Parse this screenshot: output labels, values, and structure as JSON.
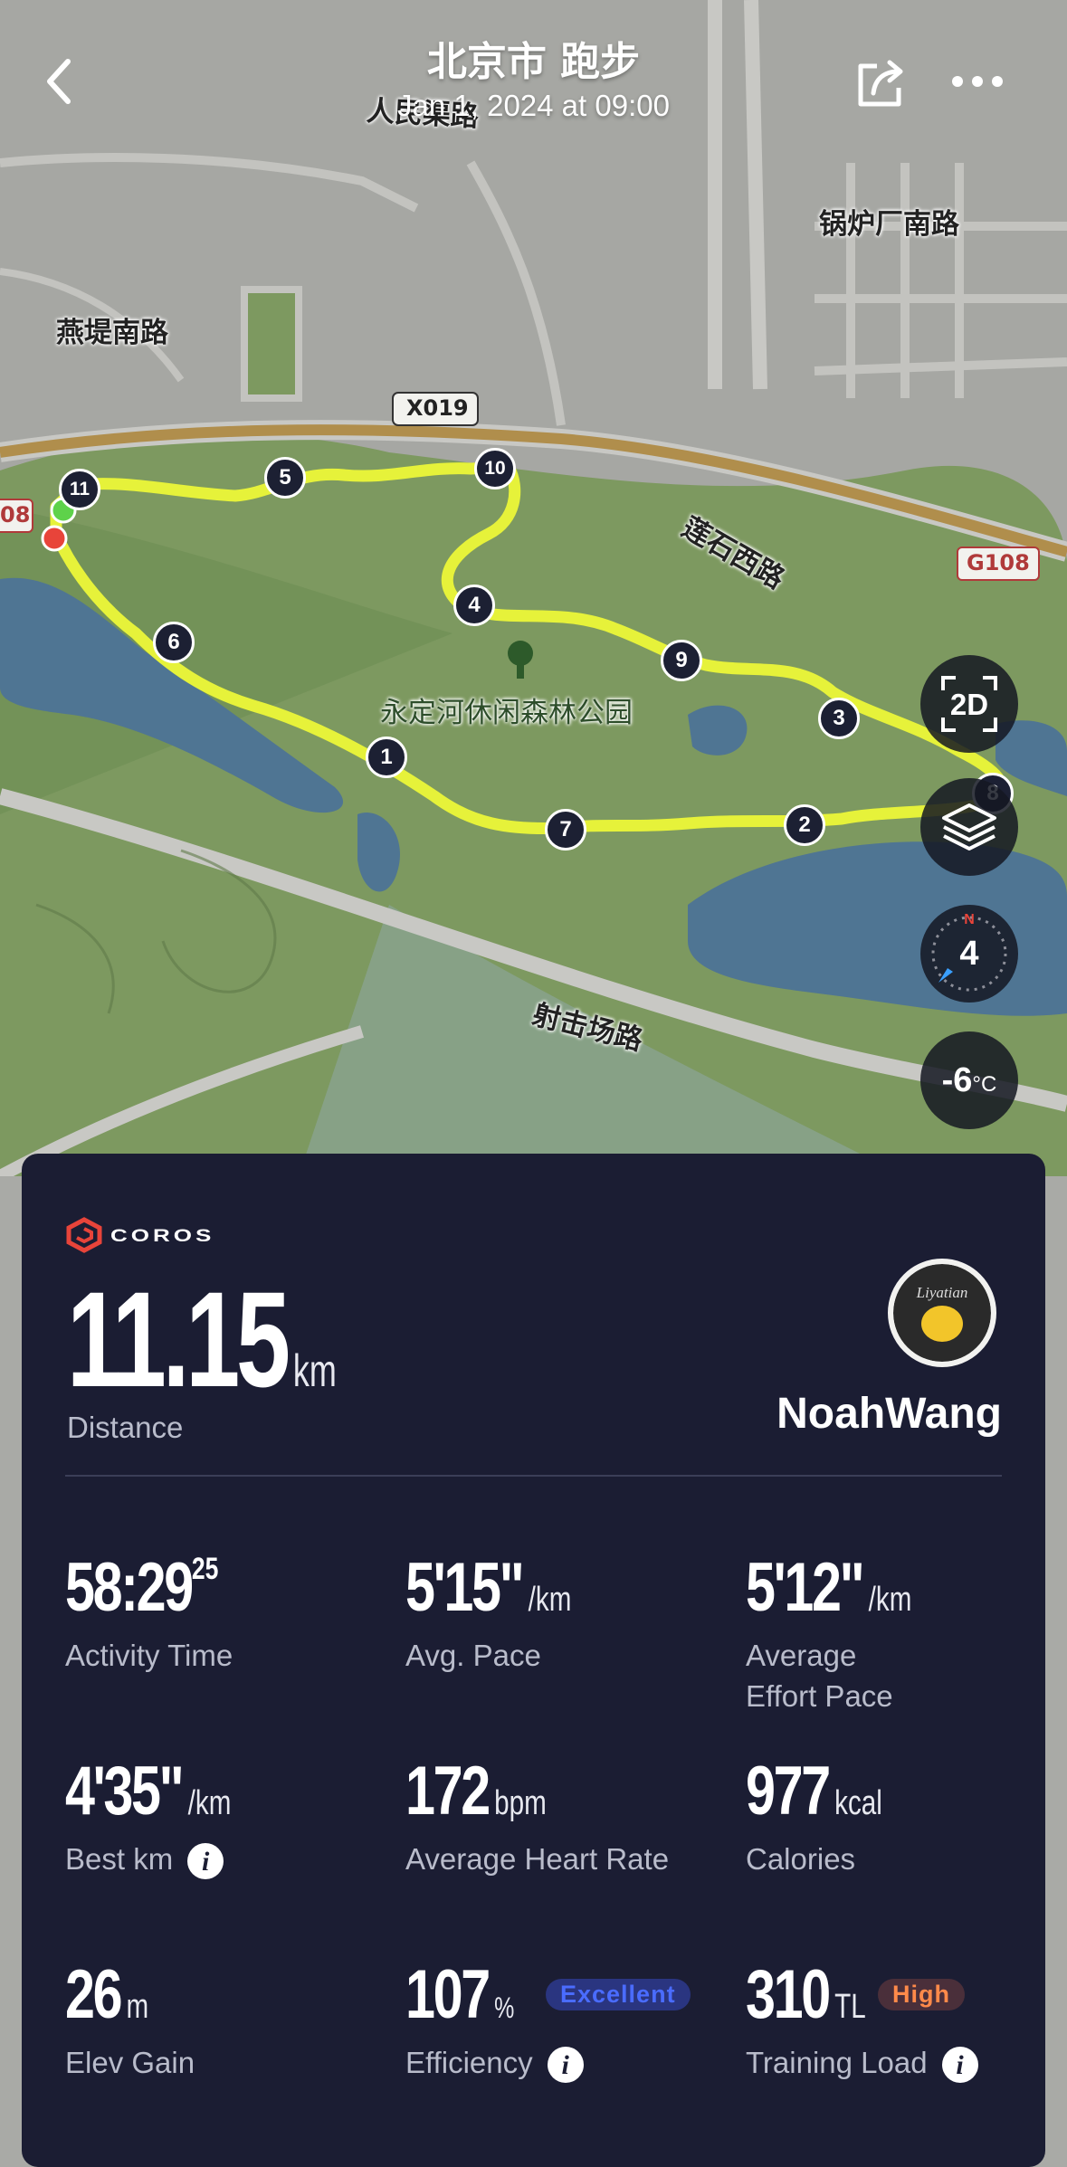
{
  "header": {
    "title": "北京市 跑步",
    "subtitle": "Jan 1, 2024 at 09:00"
  },
  "map": {
    "road_labels": [
      "人民渠路",
      "锅炉厂南路",
      "燕堤南路",
      "X019",
      "莲石西路",
      "G108",
      "永定河休闲森林公园",
      "射击场路",
      "08"
    ],
    "km_markers": [
      "1",
      "2",
      "3",
      "4",
      "5",
      "6",
      "7",
      "8",
      "9",
      "10",
      "11"
    ],
    "controls": {
      "view_mode": "2D",
      "wind": "4",
      "wind_dir": "N",
      "temperature": "-6",
      "temperature_unit": "°C"
    }
  },
  "card": {
    "brand": "COROS",
    "distance": {
      "value": "11.15",
      "unit": "km",
      "label": "Distance"
    },
    "user": {
      "name": "NoahWang",
      "avatar_text": "Liyatian"
    },
    "metrics": [
      {
        "value": "58:29",
        "sup": "25",
        "unit": "",
        "label": "Activity Time"
      },
      {
        "value": "5'15\"",
        "unit": "/km",
        "label": "Avg. Pace"
      },
      {
        "value": "5'12\"",
        "unit": "/km",
        "label": "Average",
        "label2": "Effort Pace"
      },
      {
        "value": "4'35\"",
        "unit": "/km",
        "label": "Best km"
      },
      {
        "value": "172",
        "unit": "bpm",
        "label": "Average Heart Rate"
      },
      {
        "value": "977",
        "unit": "kcal",
        "label": "Calories"
      },
      {
        "value": "26",
        "unit": "m",
        "label": "Elev Gain"
      },
      {
        "value": "107",
        "unit": "%",
        "badge": "Excellent",
        "label": "Efficiency"
      },
      {
        "value": "310",
        "unit": "TL",
        "badge": "High",
        "label": "Training Load"
      }
    ]
  },
  "colors": {
    "route": "#e6f23a",
    "card_bg": "#1b1d33",
    "brand_red": "#e8443a",
    "badge_blue": "#4a6cff",
    "badge_orange": "#ff8a4a"
  }
}
